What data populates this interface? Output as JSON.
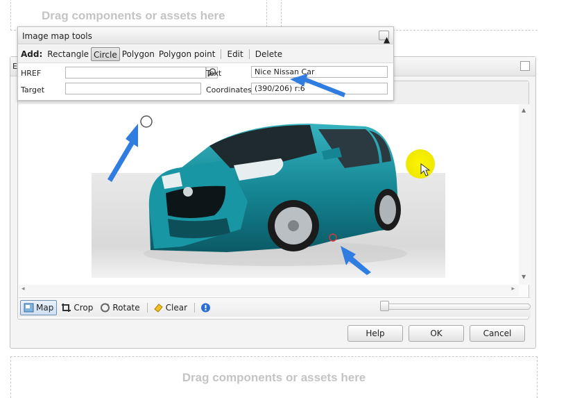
{
  "drop_zones": {
    "top_label": "Drag components or assets here",
    "bottom_label": "Drag components or assets here"
  },
  "dialog": {
    "header_initial": "E",
    "buttons": {
      "help": "Help",
      "ok": "OK",
      "cancel": "Cancel"
    }
  },
  "image_map_tools": {
    "title": "Image map tools",
    "add_label": "Add:",
    "add_options": [
      "Rectangle",
      "Circle",
      "Polygon",
      "Polygon point"
    ],
    "selected_option": "Circle",
    "edit_label": "Edit",
    "delete_label": "Delete",
    "href_label": "HREF",
    "href_value": "",
    "target_label": "Target",
    "target_value": "",
    "text_label": "Text",
    "text_value": "Nice Nissan Car",
    "coordinates_label": "Coordinates",
    "coordinates_value": "(390/206) r:6"
  },
  "image_toolbar": {
    "map_label": "Map",
    "crop_label": "Crop",
    "rotate_label": "Rotate",
    "clear_label": "Clear",
    "active_tool": "Map",
    "zoom_level": 0
  },
  "colors": {
    "car_body": "#1a8f9c",
    "highlight": "#f3f000",
    "arrow": "#2f7de0",
    "map_marker": "#d23a3a"
  }
}
